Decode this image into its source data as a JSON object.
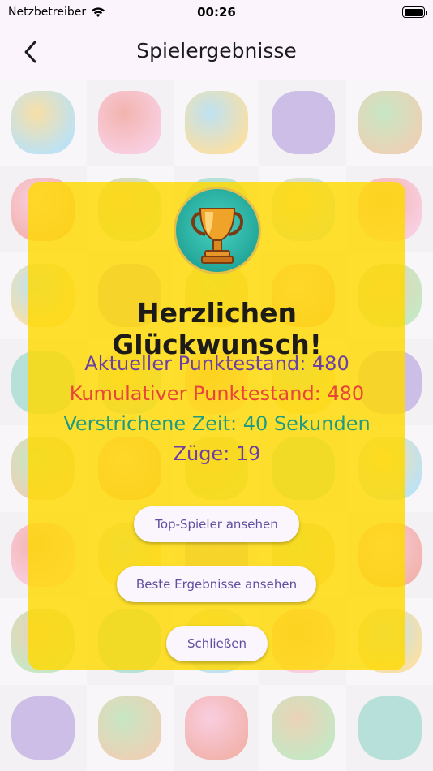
{
  "status_bar": {
    "carrier": "Netzbetreiber",
    "time": "00:26",
    "battery_level": 1.0
  },
  "nav": {
    "title": "Spielergebnisse"
  },
  "dialog": {
    "title": "Herzlichen Glückwunsch!",
    "current_score": "Aktueller Punktestand: 480",
    "cumulative_score": "Kumulativer Punktestand: 480",
    "elapsed_time": "Verstrichene Zeit: 40 Sekunden",
    "moves": "Züge: 19",
    "buttons": {
      "top_players": "Top-Spieler ansehen",
      "best_results": "Beste Ergebnisse ansehen",
      "close": "Schließen"
    }
  },
  "tiles": [
    "tram",
    "girl-soccer",
    "motocross",
    "books",
    "pizza",
    "duck",
    "soccer-ball",
    "telephone",
    "unicorn",
    "dog",
    "snail",
    "trumpet",
    "trumpet-2",
    "bicycle",
    "dog-2",
    "globe",
    "mountain",
    "skyscraper",
    "fire-truck",
    "fire-truck-2",
    "steak",
    "tennis-player",
    "star",
    "chicken",
    "cow",
    "boy",
    "robot",
    "star-2",
    "bird",
    "airplane",
    "plant",
    "strawberry",
    "burger",
    "burger-2",
    "tennis-rackets",
    "hamster",
    "flamingo",
    "apple",
    "slot-machine",
    "cat"
  ],
  "colors": {
    "dialog_bg": "#ffd900",
    "current_score": "#6a3fa6",
    "cumulative_score": "#e8443a",
    "elapsed_time": "#1f9b82",
    "moves": "#6a3fa6",
    "button_text": "#5f4fa0"
  }
}
